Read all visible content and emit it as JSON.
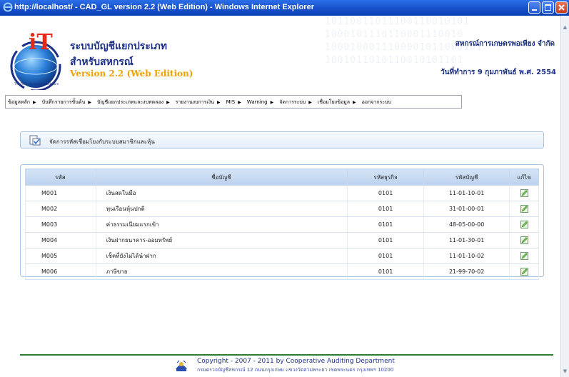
{
  "browser": {
    "title": "http://localhost/ - CAD_GL version 2.2 (Web Edition) - Windows Internet Explorer"
  },
  "header": {
    "title_line1": "ระบบบัญชีแยกประเภท",
    "title_line2": "สำหรับสหกรณ์",
    "version": "Version 2.2 (Web Edition)",
    "coop_name": "สหกรณ์การเกษตรพอเพียง จำกัด",
    "work_date": "วันที่ทำการ 9 กุมภาพันธ์ พ.ศ. 2554",
    "logo_text": "iT",
    "logo_ring_text": "The Fiscal Accounting Software",
    "binary_rows": [
      "10110011011100110010101",
      "1000101110110001110010",
      "1000100011100001011000101",
      "1001011010110010101101"
    ]
  },
  "menu": {
    "items": [
      "ข้อมูลหลัก",
      "บันทึกรายการขั้นต้น",
      "บัญชีแยกประเภทและงบทดลอง",
      "รายงานงบการเงิน",
      "MIS",
      "Warning",
      "จัดการระบบ",
      "เชื่อมโยงข้อมูล",
      "ออกจากระบบ"
    ]
  },
  "page": {
    "heading": "จัดการรหัสเชื่อมโยงกับระบบสมาชิกและหุ้น"
  },
  "table": {
    "headers": [
      "รหัส",
      "ชื่อบัญชี",
      "รหัสธุรกิจ",
      "รหัสบัญชี",
      "แก้ไข"
    ],
    "rows": [
      {
        "code": "M001",
        "name": "เงินสดในมือ",
        "biz": "0101",
        "acc": "11-01-10-01"
      },
      {
        "code": "M002",
        "name": "ทุนเรือนหุ้นปกติ",
        "biz": "0101",
        "acc": "31-01-00-01"
      },
      {
        "code": "M003",
        "name": "ค่าธรรมเนียมแรกเข้า",
        "biz": "0101",
        "acc": "48-05-00-00"
      },
      {
        "code": "M004",
        "name": "เงินฝากธนาคาร-ออมทรัพย์",
        "biz": "0101",
        "acc": "11-01-30-01"
      },
      {
        "code": "M005",
        "name": "เช็คที่ยังไม่ได้นำฝาก",
        "biz": "0101",
        "acc": "11-01-10-02"
      },
      {
        "code": "M006",
        "name": "ภาษีขาย",
        "biz": "0101",
        "acc": "21-99-70-02"
      }
    ]
  },
  "footer": {
    "copyright": "Copyright - 2007 - 2011  by Cooperative Auditing Department",
    "address": "กรมตรวจบัญชีสหกรณ์ 12 ถนนกรุงเกษม แขวงวัดสามพระยา เขตพระนคร กรุงเทพฯ 10200"
  },
  "colors": {
    "title_blue": "#1c2f86",
    "version_orange": "#f0a000",
    "titlebar_blue": "#1750c9",
    "footer_green": "#2e7d32",
    "table_header": "#c8dbf1"
  }
}
